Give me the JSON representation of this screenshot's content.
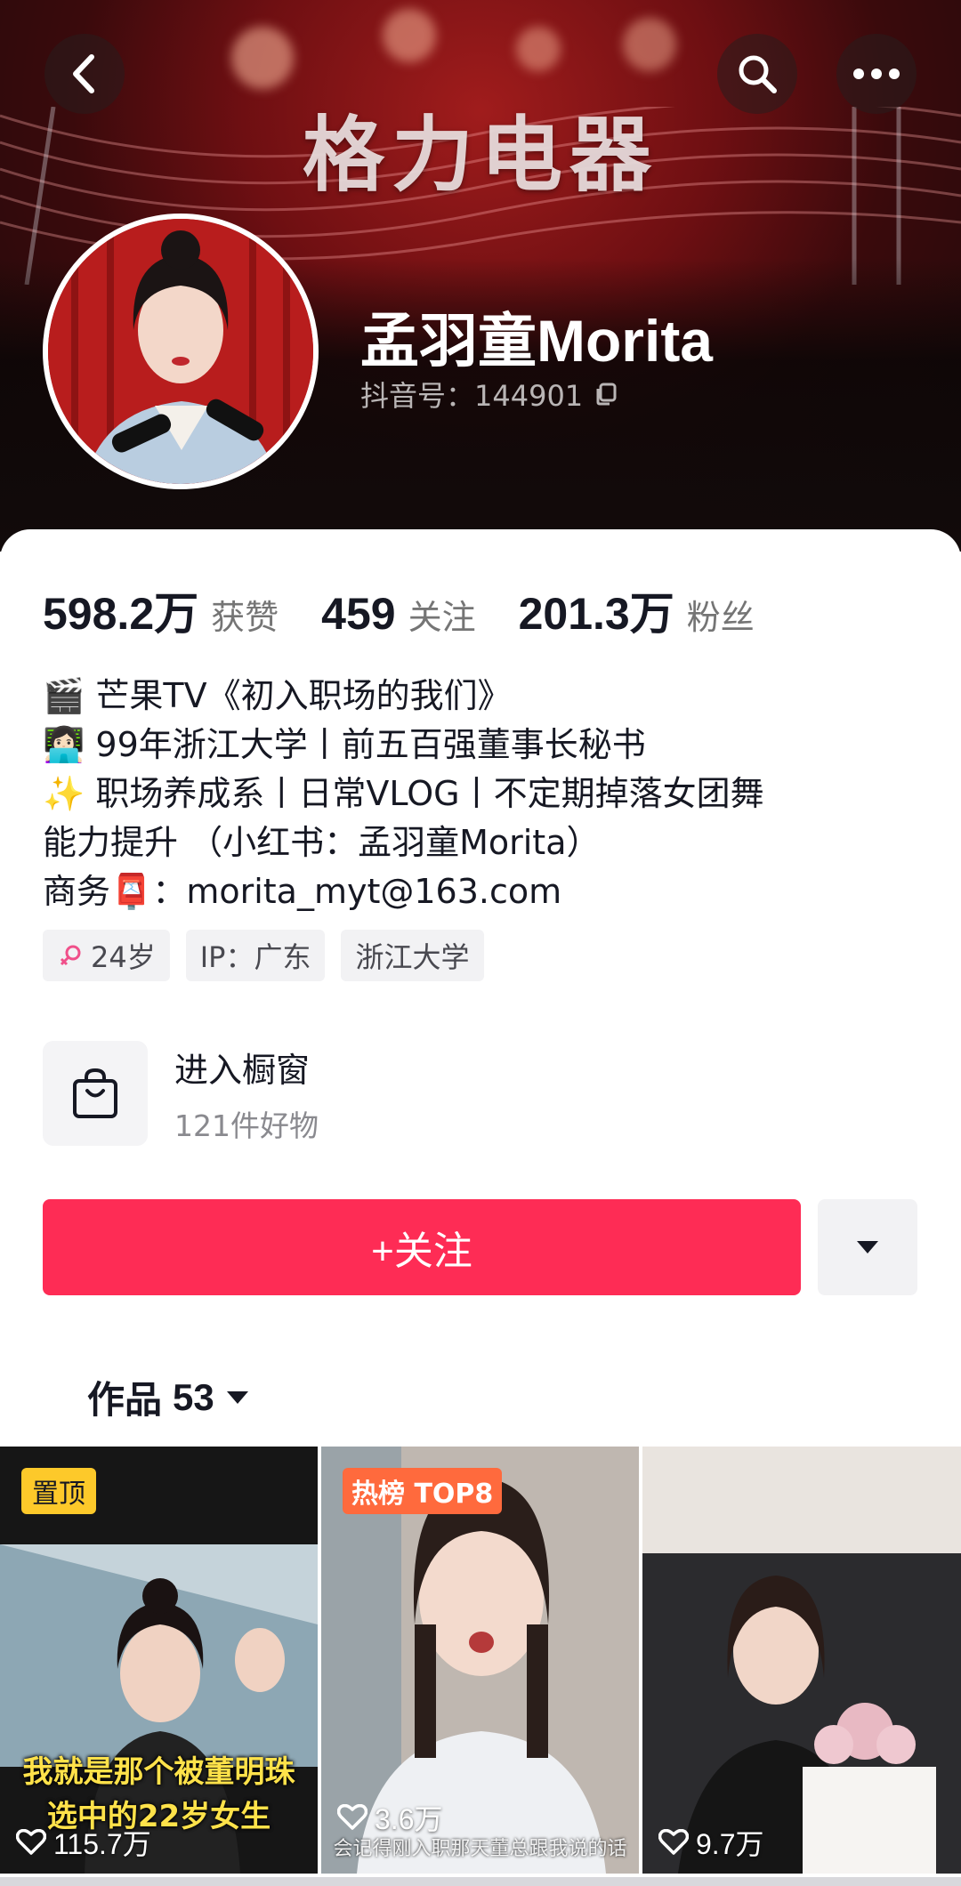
{
  "cover": {
    "brand_text": "格力电器"
  },
  "profile": {
    "nickname": "孟羽童Morita",
    "douyin_id": "抖音号：144901"
  },
  "stats": [
    {
      "value": "598.2万",
      "label": "获赞"
    },
    {
      "value": "459",
      "label": "关注"
    },
    {
      "value": "201.3万",
      "label": "粉丝"
    }
  ],
  "bio": [
    "🎬 芒果TV《初入职场的我们》",
    "👩🏻‍💻 99年浙江大学丨前五百强董事长秘书",
    "✨ 职场养成系丨日常VLOG丨不定期掉落女团舞",
    "能力提升 （小红书：孟羽童Morita）",
    "商务📮：morita_myt@163.com"
  ],
  "tags": [
    {
      "text": "24岁",
      "icon": "female-icon"
    },
    {
      "text": "IP：广东"
    },
    {
      "text": "浙江大学"
    }
  ],
  "shop": {
    "title": "进入橱窗",
    "subtitle": "121件好物",
    "icon": "shopping-bag-icon"
  },
  "actions": {
    "follow_label": "+关注",
    "dropdown_icon": "caret-down-icon"
  },
  "works_tab": {
    "label": "作品",
    "count": "53"
  },
  "videos": [
    {
      "badge": "置顶",
      "caption_line1": "我就是那个被董明珠",
      "caption_line2": "选中的22岁女生",
      "likes": "115.7万"
    },
    {
      "badge": "热榜 TOP8",
      "subtitle": "会记得刚入职那天董总跟我说的话",
      "likes": "3.6万"
    },
    {
      "likes": "9.7万"
    }
  ],
  "colors": {
    "follow_red": "#fe2c55",
    "text_primary": "#161823",
    "text_secondary": "#757575",
    "pin_badge": "#fdc92a",
    "hot_badge": "#ff6a3d"
  }
}
